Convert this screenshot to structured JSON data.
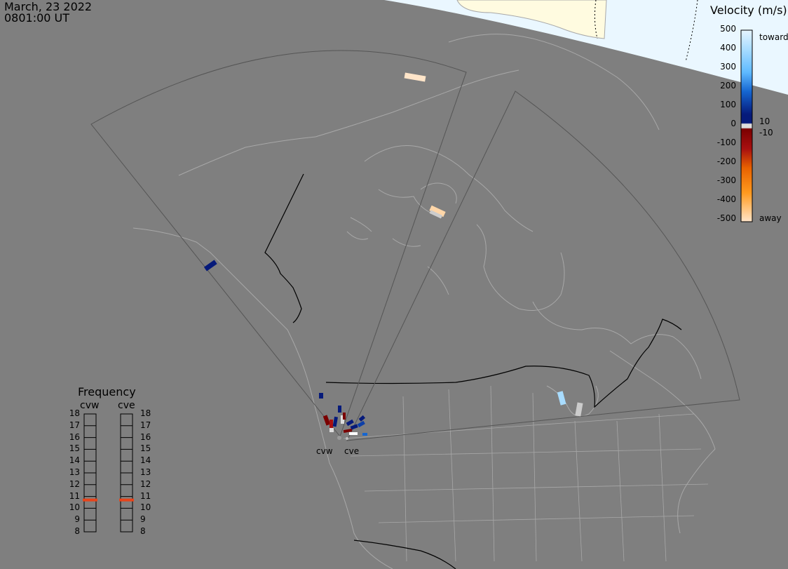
{
  "timestamp": {
    "date": "March, 23 2022",
    "time": "0801:00 UT"
  },
  "legend": {
    "title": "Velocity (m/s)",
    "ticks": [
      "500",
      "400",
      "300",
      "200",
      "100",
      "0",
      "-100",
      "-200",
      "-300",
      "-400",
      "-500"
    ],
    "toward_label": "toward",
    "away_label": "away",
    "threshold_pos": "10",
    "threshold_neg": "-10",
    "colors": [
      "#e6f4ff",
      "#a8dcff",
      "#5fbaff",
      "#1e8ff2",
      "#1566d1",
      "#0d3fa8",
      "#061a7a",
      "#dddddd",
      "#7a0000",
      "#a81010",
      "#c53a00",
      "#e86200",
      "#ff9a1f",
      "#ffcb8a",
      "#ffe5c9"
    ]
  },
  "frequency": {
    "title": "Frequency",
    "radars": [
      "cvw",
      "cve"
    ],
    "scale": [
      "18",
      "17",
      "16",
      "15",
      "14",
      "13",
      "12",
      "11",
      "10",
      "9",
      "8"
    ],
    "current_mhz": [
      10.7,
      10.7
    ],
    "marker_color": "#e8441a"
  },
  "sites": [
    "cvw",
    "cve"
  ],
  "map": {
    "background": "#7f7f7f",
    "daylight_color": "#eaf7ff",
    "land_color": "#fffbe0",
    "coast_color": "#a8a8a8",
    "border_color": "#000000"
  }
}
